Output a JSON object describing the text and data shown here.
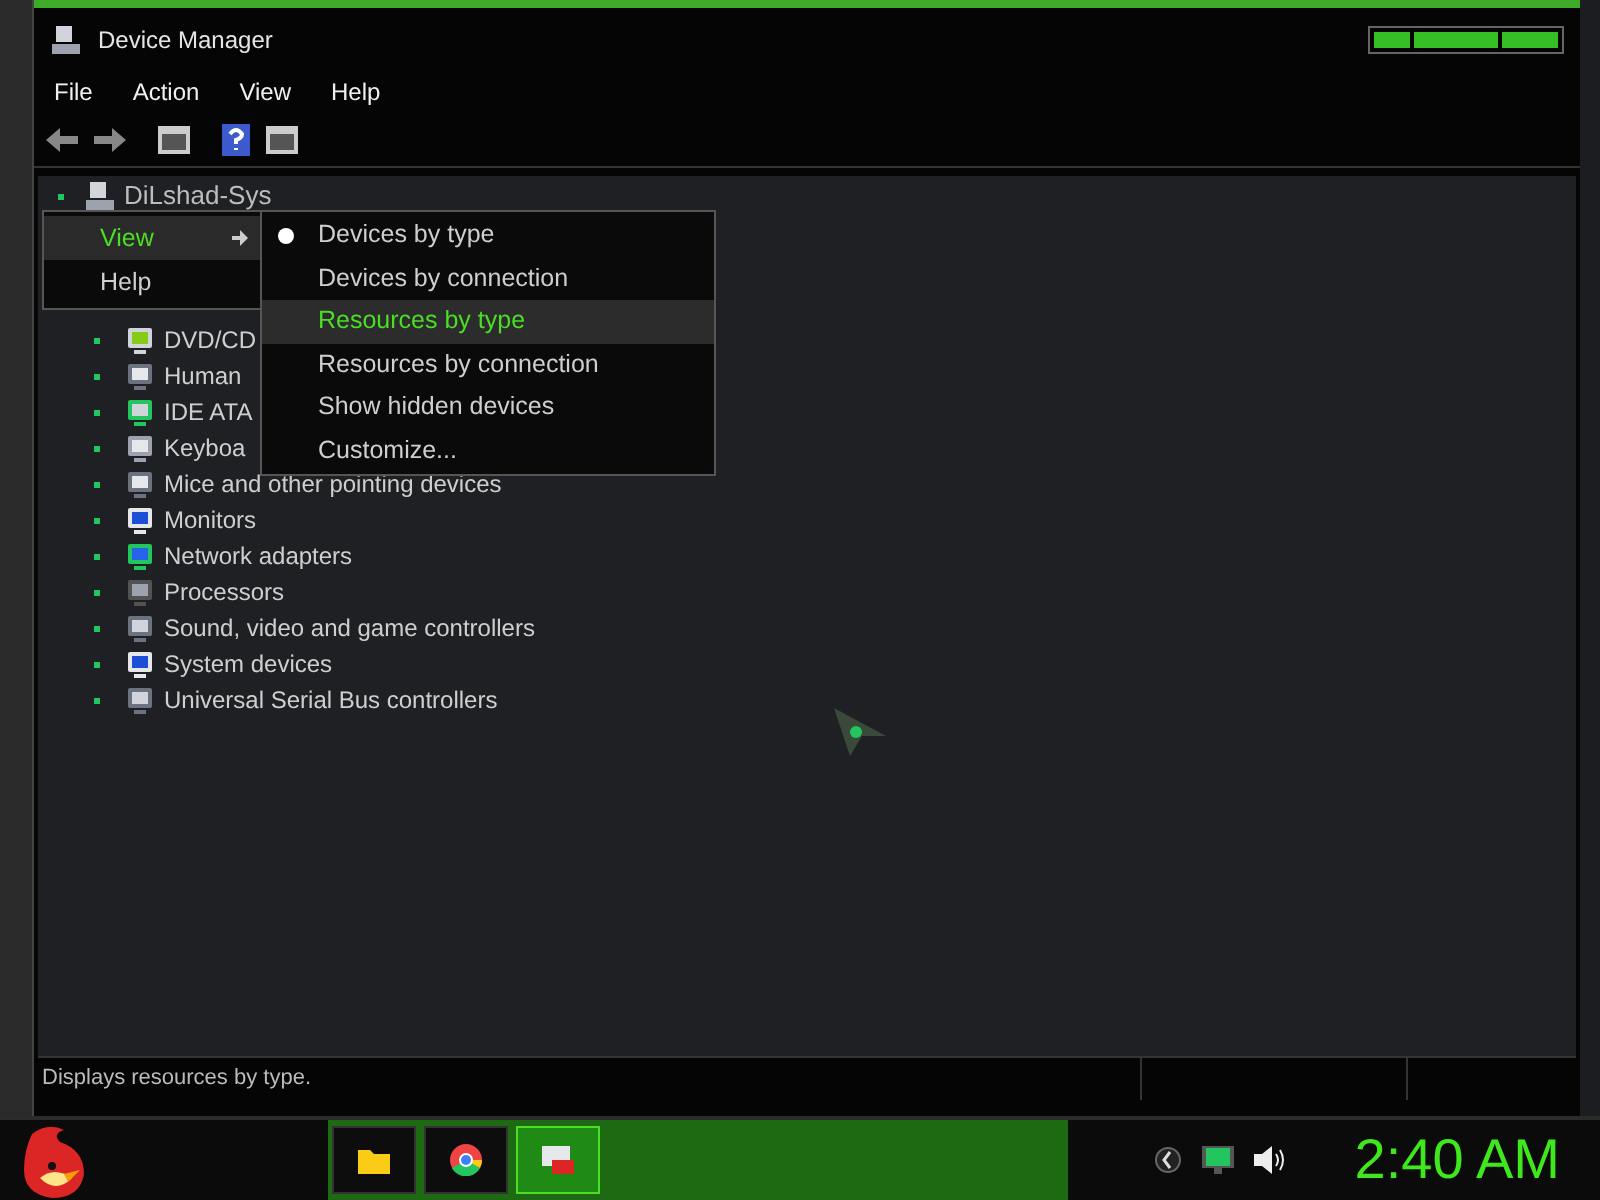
{
  "window": {
    "title": "Device Manager"
  },
  "menu_bar": [
    "File",
    "Action",
    "View",
    "Help"
  ],
  "tree": {
    "label": "DiLshad-Sys",
    "children": [
      {
        "label": "DVD/CD"
      },
      {
        "label": "Human"
      },
      {
        "label": "IDE ATA"
      },
      {
        "label": "Keyboa"
      },
      {
        "label": "Mice and other pointing devices"
      },
      {
        "label": "Monitors"
      },
      {
        "label": "Network adapters"
      },
      {
        "label": "Processors"
      },
      {
        "label": "Sound, video and game controllers"
      },
      {
        "label": "System devices"
      },
      {
        "label": "Universal Serial Bus controllers"
      }
    ]
  },
  "context_menu": [
    {
      "label": "View",
      "selected": true,
      "submenu": true
    },
    {
      "label": "Help",
      "selected": false,
      "submenu": false
    }
  ],
  "submenu": [
    {
      "label": "Devices by type",
      "selected": false,
      "checked": true
    },
    {
      "label": "Devices by connection",
      "selected": false,
      "checked": false
    },
    {
      "label": "Resources by type",
      "selected": true,
      "checked": false
    },
    {
      "label": "Resources by connection",
      "selected": false,
      "checked": false
    },
    {
      "label": "Show hidden devices",
      "selected": false,
      "checked": false
    },
    {
      "label": "Customize...",
      "selected": false,
      "checked": false
    }
  ],
  "status_bar": "Displays resources by type.",
  "taskbar": {
    "clock": "2:40 AM",
    "apps": [
      {
        "kind": "folder",
        "selected": false
      },
      {
        "kind": "browser",
        "selected": false
      },
      {
        "kind": "devmgr",
        "selected": true
      }
    ]
  }
}
